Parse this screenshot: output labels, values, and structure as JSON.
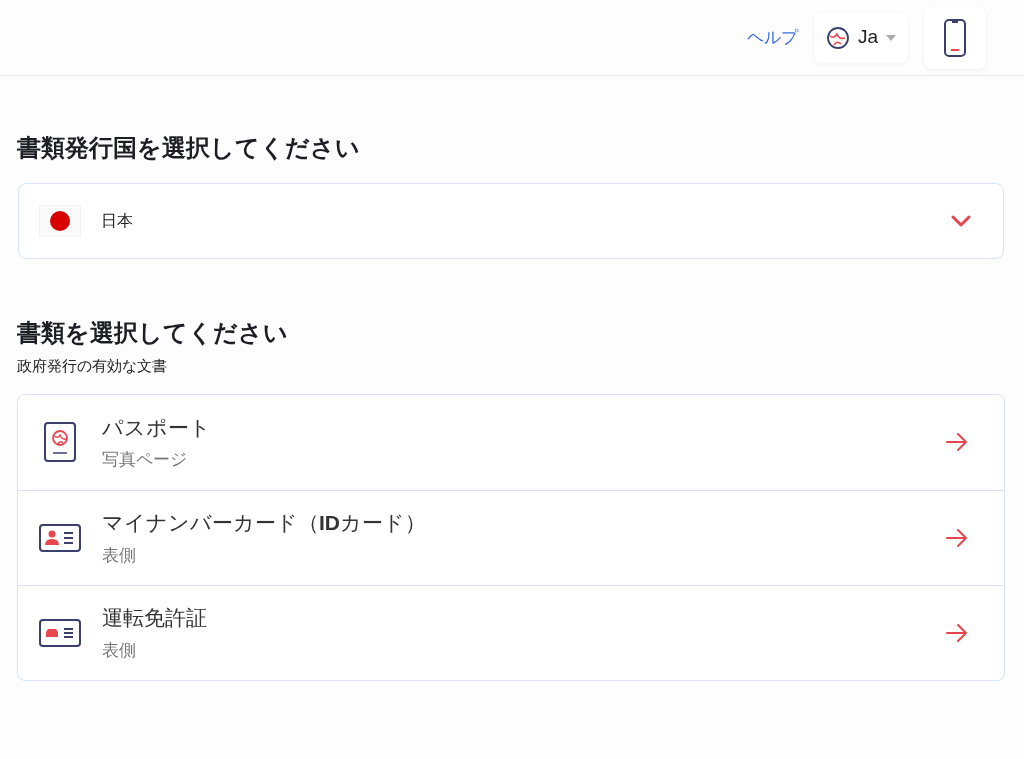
{
  "header": {
    "help_link": "ヘルプ",
    "language": "Ja"
  },
  "country_section": {
    "title": "書類発行国を選択してください",
    "selected_country": "日本"
  },
  "document_section": {
    "title": "書類を選択してください",
    "subtitle": "政府発行の有効な文書",
    "documents": [
      {
        "kind": "passport",
        "name": "パスポート",
        "side": "写真ページ"
      },
      {
        "kind": "id-card",
        "name": "マイナンバーカード（**ID**カード）",
        "side": "表側"
      },
      {
        "kind": "license",
        "name": "運転免許証",
        "side": "表側"
      }
    ]
  }
}
